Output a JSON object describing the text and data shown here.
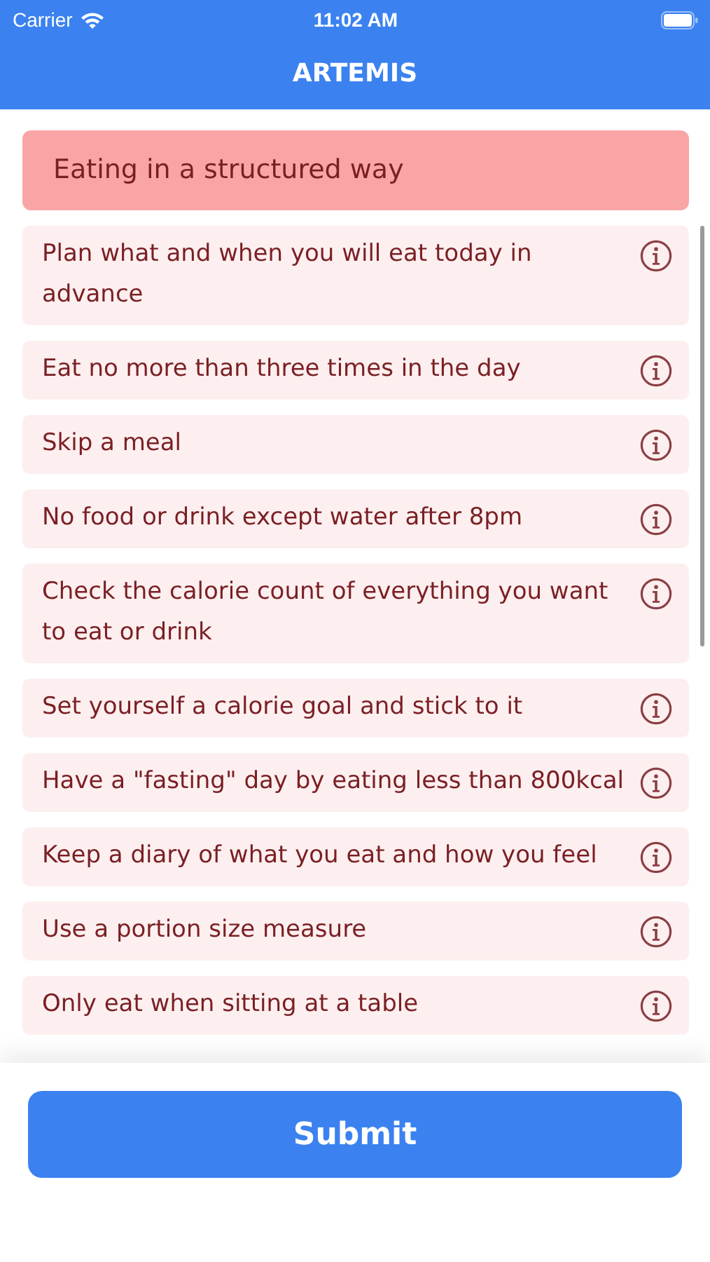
{
  "status_bar": {
    "carrier": "Carrier",
    "time": "11:02 AM"
  },
  "header": {
    "title": "ARTEMIS"
  },
  "section": {
    "title": "Eating in a structured way"
  },
  "items": [
    {
      "label": "Plan what and when you will eat today in advance"
    },
    {
      "label": "Eat no more than three times in the day"
    },
    {
      "label": "Skip a meal"
    },
    {
      "label": "No food or drink except water after 8pm"
    },
    {
      "label": "Check the calorie count of everything you want to eat or drink"
    },
    {
      "label": "Set yourself a calorie goal and stick to it"
    },
    {
      "label": "Have a \"fasting\" day by eating less than 800kcal"
    },
    {
      "label": "Keep a diary of what you eat and how you feel"
    },
    {
      "label": "Use a portion size measure"
    },
    {
      "label": "Only eat when sitting at a table"
    }
  ],
  "submit": {
    "label": "Submit"
  }
}
